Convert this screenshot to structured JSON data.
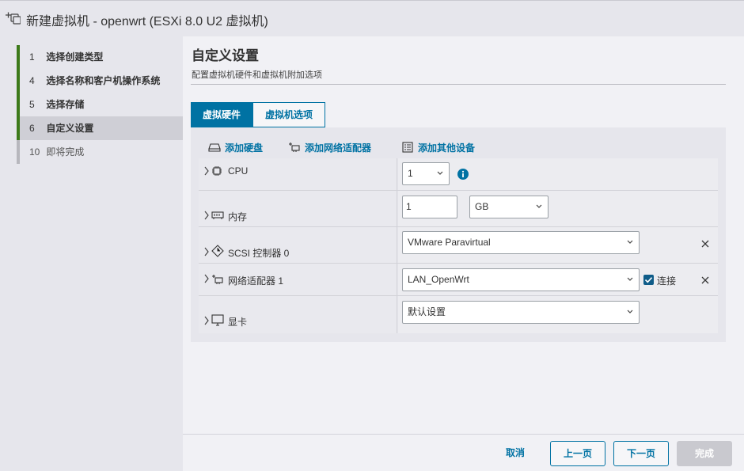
{
  "window": {
    "title": "新建虚拟机 - openwrt (ESXi 8.0 U2 虚拟机)",
    "icon": "new-vm-icon"
  },
  "sidebar": {
    "steps": [
      {
        "num": "1",
        "label": "选择创建类型",
        "state": "done"
      },
      {
        "num": "4",
        "label": "选择名称和客户机操作系统",
        "state": "done"
      },
      {
        "num": "5",
        "label": "选择存储",
        "state": "done"
      },
      {
        "num": "6",
        "label": "自定义设置",
        "state": "current"
      },
      {
        "num": "10",
        "label": "即将完成",
        "state": "pending"
      }
    ]
  },
  "main": {
    "title": "自定义设置",
    "subtitle": "配置虚拟机硬件和虚拟机附加选项",
    "tabs": [
      {
        "label": "虚拟硬件",
        "active": true
      },
      {
        "label": "虚拟机选项",
        "active": false
      }
    ]
  },
  "toolbar": {
    "add_disk": "添加硬盘",
    "add_nic": "添加网络适配器",
    "add_other": "添加其他设备"
  },
  "hardware": {
    "cpu": {
      "label": "CPU",
      "value": "1"
    },
    "memory": {
      "label": "内存",
      "value": "1",
      "unit": "GB"
    },
    "scsi": {
      "label": "SCSI 控制器 0",
      "value": "VMware Paravirtual"
    },
    "nic": {
      "label": "网络适配器 1",
      "value": "LAN_OpenWrt",
      "connect_label": "连接",
      "connected": true
    },
    "display": {
      "label": "显卡",
      "value": "默认设置"
    }
  },
  "footer": {
    "cancel": "取消",
    "back": "上一页",
    "next": "下一页",
    "finish": "完成"
  },
  "colors": {
    "accent": "#0072a3",
    "completed_step": "#3d7a1a",
    "pending_step": "#b7b7bd",
    "disabled_button": "#c9c9cf"
  }
}
